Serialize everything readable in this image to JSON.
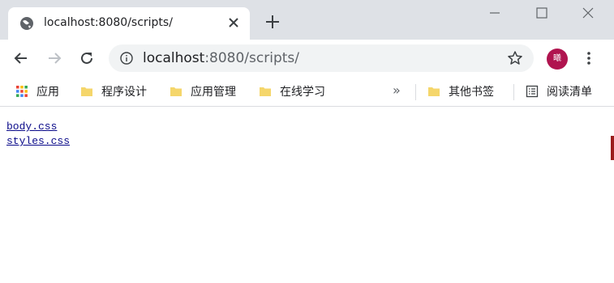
{
  "tab": {
    "title": "localhost:8080/scripts/",
    "favicon": "globe-icon"
  },
  "window_controls": [
    "minimize-icon",
    "maximize-icon",
    "close-icon"
  ],
  "toolbar": {
    "url_host": "localhost",
    "url_rest": ":8080/scripts/",
    "avatar_text": "曦"
  },
  "bookmarks": {
    "items": [
      {
        "label": "应用",
        "icon": "apps-grid-icon"
      },
      {
        "label": "程序设计",
        "icon": "folder-icon"
      },
      {
        "label": "应用管理",
        "icon": "folder-icon"
      },
      {
        "label": "在线学习",
        "icon": "folder-icon"
      }
    ],
    "more": "»",
    "other": {
      "label": "其他书签",
      "icon": "folder-icon"
    },
    "reading_list": {
      "label": "阅读清单",
      "icon": "reading-list-icon"
    }
  },
  "directory": {
    "files": [
      "body.css",
      "styles.css"
    ]
  },
  "colors": {
    "link": "#0b0b8a",
    "avatar": "#b0144f",
    "folder": "#f5d66b"
  }
}
